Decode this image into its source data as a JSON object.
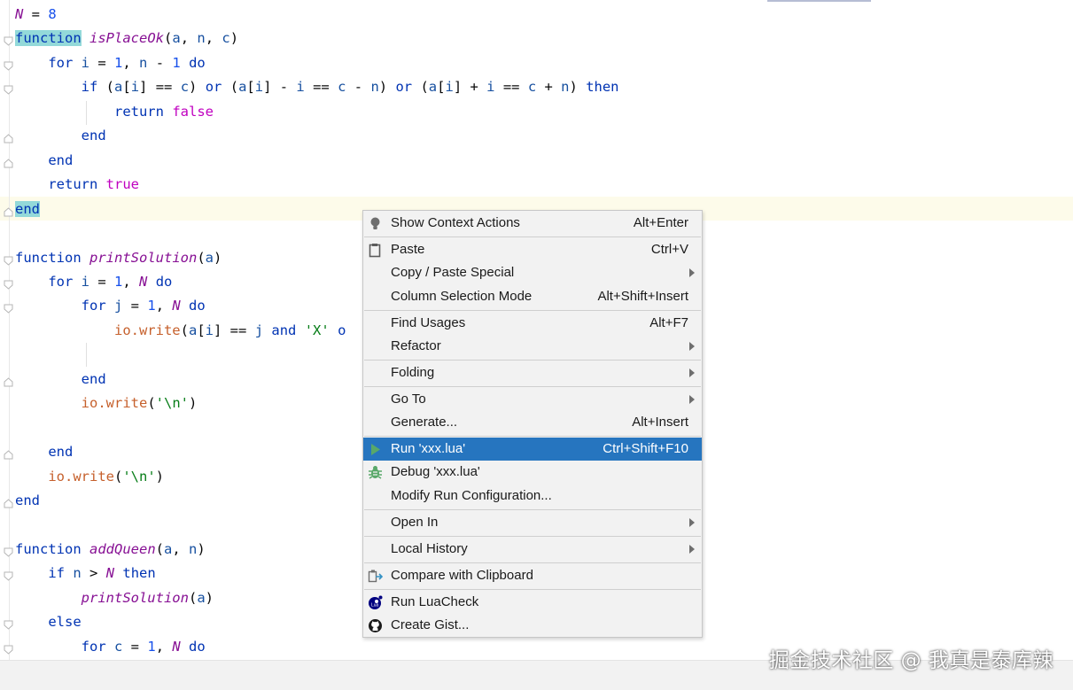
{
  "editor": {
    "lines": [
      [
        [
          "gl",
          "N"
        ],
        [
          "op",
          " = "
        ],
        [
          "num",
          "8"
        ]
      ],
      [
        [
          "kw hl",
          "function"
        ],
        [
          "op",
          " "
        ],
        [
          "fn",
          "isPlaceOk"
        ],
        [
          "op",
          "("
        ],
        [
          "id",
          "a"
        ],
        [
          "op",
          ", "
        ],
        [
          "id",
          "n"
        ],
        [
          "op",
          ", "
        ],
        [
          "id",
          "c"
        ],
        [
          "op",
          ")"
        ]
      ],
      [
        [
          "op",
          "    "
        ],
        [
          "kw",
          "for"
        ],
        [
          "op",
          " "
        ],
        [
          "id",
          "i"
        ],
        [
          "op",
          " = "
        ],
        [
          "num",
          "1"
        ],
        [
          "op",
          ", "
        ],
        [
          "id",
          "n"
        ],
        [
          "op",
          " - "
        ],
        [
          "num",
          "1"
        ],
        [
          "op",
          " "
        ],
        [
          "kw",
          "do"
        ]
      ],
      [
        [
          "op",
          "        "
        ],
        [
          "kw",
          "if"
        ],
        [
          "op",
          " ("
        ],
        [
          "id",
          "a"
        ],
        [
          "op",
          "["
        ],
        [
          "id",
          "i"
        ],
        [
          "op",
          "] == "
        ],
        [
          "id",
          "c"
        ],
        [
          "op",
          ") "
        ],
        [
          "kw",
          "or"
        ],
        [
          "op",
          " ("
        ],
        [
          "id",
          "a"
        ],
        [
          "op",
          "["
        ],
        [
          "id",
          "i"
        ],
        [
          "op",
          "] - "
        ],
        [
          "id",
          "i"
        ],
        [
          "op",
          " == "
        ],
        [
          "id",
          "c"
        ],
        [
          "op",
          " - "
        ],
        [
          "id",
          "n"
        ],
        [
          "op",
          ") "
        ],
        [
          "kw",
          "or"
        ],
        [
          "op",
          " ("
        ],
        [
          "id",
          "a"
        ],
        [
          "op",
          "["
        ],
        [
          "id",
          "i"
        ],
        [
          "op",
          "] + "
        ],
        [
          "id",
          "i"
        ],
        [
          "op",
          " == "
        ],
        [
          "id",
          "c"
        ],
        [
          "op",
          " + "
        ],
        [
          "id",
          "n"
        ],
        [
          "op",
          ") "
        ],
        [
          "kw",
          "then"
        ]
      ],
      [
        [
          "op",
          "            "
        ],
        [
          "kw",
          "return"
        ],
        [
          "op",
          " "
        ],
        [
          "bool",
          "false"
        ]
      ],
      [
        [
          "op",
          "        "
        ],
        [
          "kw",
          "end"
        ]
      ],
      [
        [
          "op",
          "    "
        ],
        [
          "kw",
          "end"
        ]
      ],
      [
        [
          "op",
          "    "
        ],
        [
          "kw",
          "return"
        ],
        [
          "op",
          " "
        ],
        [
          "bool",
          "true"
        ]
      ],
      [
        [
          "kw hl",
          "end"
        ]
      ],
      [],
      [
        [
          "kw",
          "function"
        ],
        [
          "op",
          " "
        ],
        [
          "fn",
          "printSolution"
        ],
        [
          "op",
          "("
        ],
        [
          "id",
          "a"
        ],
        [
          "op",
          ")"
        ]
      ],
      [
        [
          "op",
          "    "
        ],
        [
          "kw",
          "for"
        ],
        [
          "op",
          " "
        ],
        [
          "id",
          "i"
        ],
        [
          "op",
          " = "
        ],
        [
          "num",
          "1"
        ],
        [
          "op",
          ", "
        ],
        [
          "gl",
          "N"
        ],
        [
          "op",
          " "
        ],
        [
          "kw",
          "do"
        ]
      ],
      [
        [
          "op",
          "        "
        ],
        [
          "kw",
          "for"
        ],
        [
          "op",
          " "
        ],
        [
          "id",
          "j"
        ],
        [
          "op",
          " = "
        ],
        [
          "num",
          "1"
        ],
        [
          "op",
          ", "
        ],
        [
          "gl",
          "N"
        ],
        [
          "op",
          " "
        ],
        [
          "kw",
          "do"
        ]
      ],
      [
        [
          "op",
          "            "
        ],
        [
          "lib",
          "io.write"
        ],
        [
          "op",
          "("
        ],
        [
          "id",
          "a"
        ],
        [
          "op",
          "["
        ],
        [
          "id",
          "i"
        ],
        [
          "op",
          "] == "
        ],
        [
          "id",
          "j"
        ],
        [
          "op",
          " "
        ],
        [
          "kw",
          "and"
        ],
        [
          "op",
          " "
        ],
        [
          "str",
          "'X'"
        ],
        [
          "op",
          " "
        ],
        [
          "kw",
          "o"
        ]
      ],
      [],
      [
        [
          "op",
          "        "
        ],
        [
          "kw",
          "end"
        ]
      ],
      [
        [
          "op",
          "        "
        ],
        [
          "lib",
          "io.write"
        ],
        [
          "op",
          "("
        ],
        [
          "str",
          "'\\n'"
        ],
        [
          "op",
          ")"
        ]
      ],
      [],
      [
        [
          "op",
          "    "
        ],
        [
          "kw",
          "end"
        ]
      ],
      [
        [
          "op",
          "    "
        ],
        [
          "lib",
          "io.write"
        ],
        [
          "op",
          "("
        ],
        [
          "str",
          "'\\n'"
        ],
        [
          "op",
          ")"
        ]
      ],
      [
        [
          "kw",
          "end"
        ]
      ],
      [],
      [
        [
          "kw",
          "function"
        ],
        [
          "op",
          " "
        ],
        [
          "fn",
          "addQueen"
        ],
        [
          "op",
          "("
        ],
        [
          "id",
          "a"
        ],
        [
          "op",
          ", "
        ],
        [
          "id",
          "n"
        ],
        [
          "op",
          ")"
        ]
      ],
      [
        [
          "op",
          "    "
        ],
        [
          "kw",
          "if"
        ],
        [
          "op",
          " "
        ],
        [
          "id",
          "n"
        ],
        [
          "op",
          " > "
        ],
        [
          "gl",
          "N"
        ],
        [
          "op",
          " "
        ],
        [
          "kw",
          "then"
        ]
      ],
      [
        [
          "op",
          "        "
        ],
        [
          "fn",
          "printSolution"
        ],
        [
          "op",
          "("
        ],
        [
          "id",
          "a"
        ],
        [
          "op",
          ")"
        ]
      ],
      [
        [
          "op",
          "    "
        ],
        [
          "kw",
          "else"
        ]
      ],
      [
        [
          "op",
          "        "
        ],
        [
          "kw",
          "for"
        ],
        [
          "op",
          " "
        ],
        [
          "id",
          "c"
        ],
        [
          "op",
          " = "
        ],
        [
          "num",
          "1"
        ],
        [
          "op",
          ", "
        ],
        [
          "gl",
          "N"
        ],
        [
          "op",
          " "
        ],
        [
          "kw",
          "do"
        ]
      ]
    ]
  },
  "context_menu": {
    "items": [
      {
        "name": "show-context-actions",
        "label": "Show Context Actions",
        "shortcut": "Alt+Enter",
        "icon": "bulb-icon",
        "submenu": false
      },
      {
        "name": "paste",
        "label": "Paste",
        "shortcut": "Ctrl+V",
        "icon": "clipboard-icon",
        "submenu": false
      },
      {
        "name": "copy-paste-special",
        "label": "Copy / Paste Special",
        "shortcut": "",
        "icon": "",
        "submenu": true
      },
      {
        "name": "column-selection-mode",
        "label": "Column Selection Mode",
        "shortcut": "Alt+Shift+Insert",
        "icon": "",
        "submenu": false
      },
      {
        "name": "find-usages",
        "label": "Find Usages",
        "shortcut": "Alt+F7",
        "icon": "",
        "submenu": false
      },
      {
        "name": "refactor",
        "label": "Refactor",
        "shortcut": "",
        "icon": "",
        "submenu": true
      },
      {
        "name": "folding",
        "label": "Folding",
        "shortcut": "",
        "icon": "",
        "submenu": true
      },
      {
        "name": "go-to",
        "label": "Go To",
        "shortcut": "",
        "icon": "",
        "submenu": true
      },
      {
        "name": "generate",
        "label": "Generate...",
        "shortcut": "Alt+Insert",
        "icon": "",
        "submenu": false
      },
      {
        "name": "run",
        "label": "Run 'xxx.lua'",
        "shortcut": "Ctrl+Shift+F10",
        "icon": "run-icon",
        "submenu": false,
        "selected": true
      },
      {
        "name": "debug",
        "label": "Debug 'xxx.lua'",
        "shortcut": "",
        "icon": "bug-icon",
        "submenu": false
      },
      {
        "name": "modify-run-configuration",
        "label": "Modify Run Configuration...",
        "shortcut": "",
        "icon": "",
        "submenu": false
      },
      {
        "name": "open-in",
        "label": "Open In",
        "shortcut": "",
        "icon": "",
        "submenu": true
      },
      {
        "name": "local-history",
        "label": "Local History",
        "shortcut": "",
        "icon": "",
        "submenu": true
      },
      {
        "name": "compare-with-clipboard",
        "label": "Compare with Clipboard",
        "shortcut": "",
        "icon": "compare-icon",
        "submenu": false
      },
      {
        "name": "run-luacheck",
        "label": "Run LuaCheck",
        "shortcut": "",
        "icon": "lua-icon",
        "submenu": false
      },
      {
        "name": "create-gist",
        "label": "Create Gist...",
        "shortcut": "",
        "icon": "github-icon",
        "submenu": false
      }
    ]
  },
  "watermark": "掘金技术社区 @ 我真是泰库辣",
  "colors": {
    "keyword": "#0033b3",
    "function": "#871094",
    "number": "#1750eb",
    "string": "#067d17",
    "library": "#c6602c",
    "boolean": "#c000c0",
    "match_highlight": "#93d9d9",
    "selection": "#2675bf",
    "menu_background": "#f2f2f2"
  }
}
